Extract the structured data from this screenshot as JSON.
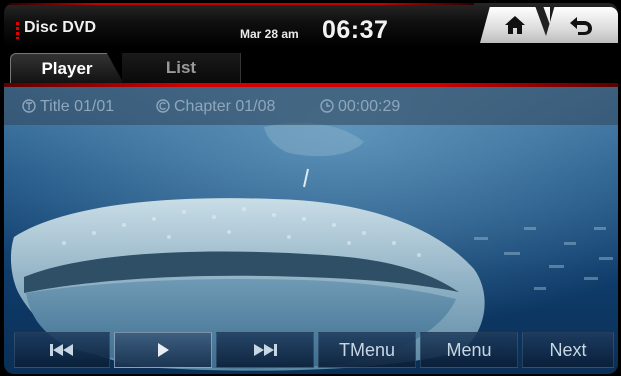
{
  "header": {
    "source_title": "Disc DVD",
    "date": "Mar 28 am",
    "time": "06:37",
    "home_icon": "home-icon",
    "back_icon": "back-arrow-icon"
  },
  "tabs": [
    {
      "label": "Player",
      "selected": true
    },
    {
      "label": "List",
      "selected": false
    }
  ],
  "info": {
    "title": "Title 01/01",
    "chapter": "Chapter 01/08",
    "elapsed": "00:00:29"
  },
  "controls": {
    "prev_icon": "skip-previous-icon",
    "play_icon": "play-icon",
    "next_icon": "skip-next-icon",
    "tmenu_label": "TMenu",
    "menu_label": "Menu",
    "next_label": "Next"
  },
  "colors": {
    "accent_red": "#d20000",
    "video_blue": "#1f5383"
  }
}
